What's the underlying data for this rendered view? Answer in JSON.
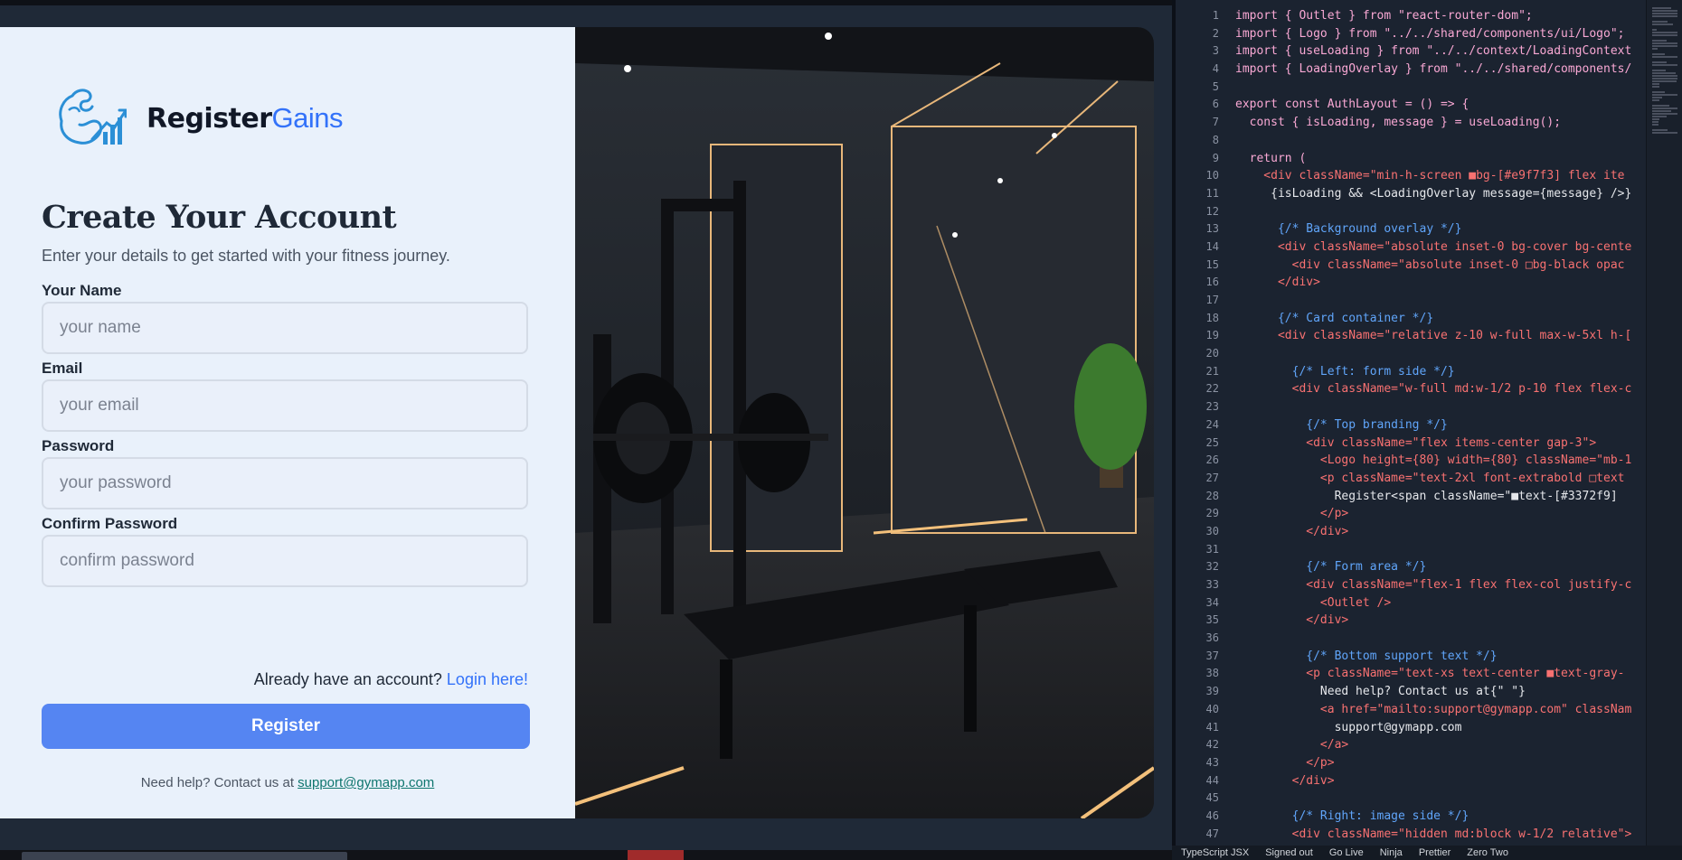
{
  "brand": {
    "part1": "Register",
    "part2": "Gains"
  },
  "form": {
    "title": "Create Your Account",
    "subtitle": "Enter your details to get started with your fitness journey.",
    "fields": [
      {
        "label": "Your Name",
        "placeholder": "your name"
      },
      {
        "label": "Email",
        "placeholder": "your email"
      },
      {
        "label": "Password",
        "placeholder": "your password"
      },
      {
        "label": "Confirm Password",
        "placeholder": "confirm password"
      }
    ],
    "login_prompt": "Already have an account?",
    "login_link": "Login here!",
    "register_label": "Register",
    "help_text": "Need help? Contact us at",
    "help_email": "support@gymapp.com"
  },
  "editor": {
    "line_numbers": [
      "1",
      "2",
      "3",
      "4",
      "5",
      "6",
      "7",
      "8",
      "9",
      "10",
      "11",
      "12",
      "13",
      "14",
      "15",
      "16",
      "17",
      "18",
      "19",
      "20",
      "21",
      "22",
      "23",
      "24",
      "25",
      "26",
      "27",
      "28",
      "29",
      "30",
      "31",
      "32",
      "33",
      "34",
      "35",
      "36",
      "37",
      "38",
      "39",
      "40",
      "41",
      "42",
      "43",
      "44",
      "45",
      "46",
      "47"
    ],
    "lines": [
      "import { Outlet } from \"react-router-dom\";",
      "import { Logo } from \"../../shared/components/ui/Logo\";",
      "import { useLoading } from \"../../context/LoadingContext",
      "import { LoadingOverlay } from \"../../shared/components/",
      "",
      "export const AuthLayout = () => {",
      "  const { isLoading, message } = useLoading();",
      "",
      "  return (",
      "    <div className=\"min-h-screen ■bg-[#e9f7f3] flex ite",
      "     {isLoading && <LoadingOverlay message={message} />}",
      "",
      "      {/* Background overlay */}",
      "      <div className=\"absolute inset-0 bg-cover bg-cente",
      "        <div className=\"absolute inset-0 □bg-black opac",
      "      </div>",
      "",
      "      {/* Card container */}",
      "      <div className=\"relative z-10 w-full max-w-5xl h-[",
      "",
      "        {/* Left: form side */}",
      "        <div className=\"w-full md:w-1/2 p-10 flex flex-c",
      "",
      "          {/* Top branding */}",
      "          <div className=\"flex items-center gap-3\">",
      "            <Logo height={80} width={80} className=\"mb-1",
      "            <p className=\"text-2xl font-extrabold □text",
      "              Register<span className=\"■text-[#3372f9]",
      "            </p>",
      "          </div>",
      "",
      "          {/* Form area */}",
      "          <div className=\"flex-1 flex flex-col justify-c",
      "            <Outlet />",
      "          </div>",
      "",
      "          {/* Bottom support text */}",
      "          <p className=\"text-xs text-center ■text-gray-",
      "            Need help? Contact us at{\" \"}",
      "            <a href=\"mailto:support@gymapp.com\" classNam",
      "              support@gymapp.com",
      "            </a>",
      "          </p>",
      "        </div>",
      "",
      "        {/* Right: image side */}",
      "        <div className=\"hidden md:block w-1/2 relative\">"
    ],
    "status_items": [
      "TypeScript JSX",
      "Signed out",
      "Go Live",
      "Ninja",
      "Prettier",
      "Zero Two"
    ]
  }
}
